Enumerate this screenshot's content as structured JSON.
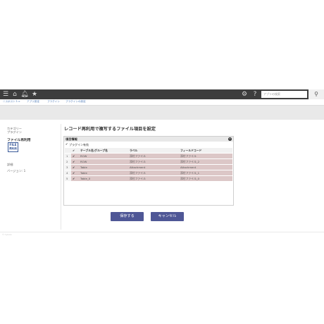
{
  "nav": {
    "icons": [
      "menu-icon",
      "home-icon",
      "bell-icon",
      "star-icon",
      "gear-icon",
      "help-icon"
    ],
    "search_placeholder": "アプリの検索"
  },
  "breadcrumbs": [
    "ニスポスト１⇒",
    "アプリ設定",
    "プラグイン",
    "プラグインの設定"
  ],
  "sidebar": {
    "category": "カテゴリー",
    "plugin_label": "プラグイン",
    "plugin_name": "ファイル再利用",
    "logo_line1": "FILE",
    "logo_line2": "再利用",
    "detail": "詳細",
    "version": "バージョン: 1"
  },
  "main": {
    "title": "レコード再利用で複写するファイル項目を設定",
    "panel_title": "項目情報",
    "enable_label": "プラグイン有効",
    "columns": [
      "",
      "✔",
      "テーブル名/グループ名",
      "ラベル",
      "フィールドコード"
    ],
    "rows": [
      {
        "no": "1",
        "check": "✔",
        "table": "ROW",
        "label": "添付ファイル",
        "code": "添付ファイル"
      },
      {
        "no": "2",
        "check": "✔",
        "table": "ROW",
        "label": "添付ファイル",
        "code": "添付ファイル_2"
      },
      {
        "no": "3",
        "check": "✔",
        "table": "Table",
        "label": "Attachment",
        "code": "Attachment"
      },
      {
        "no": "4",
        "check": "✔",
        "table": "Table",
        "label": "添付ファイル",
        "code": "添付ファイル_1"
      },
      {
        "no": "5",
        "check": "✔",
        "table": "Table_0",
        "label": "添付ファイル",
        "code": "添付ファイル_0"
      }
    ]
  },
  "buttons": {
    "save": "保存する",
    "cancel": "キャンセル"
  },
  "footer": {
    "note": "© Cybozu"
  },
  "colors": {
    "topbar": "#3d3d3d",
    "row_highlight": "#dcc7c7",
    "button": "#4f5796",
    "link": "#4a77b4"
  }
}
